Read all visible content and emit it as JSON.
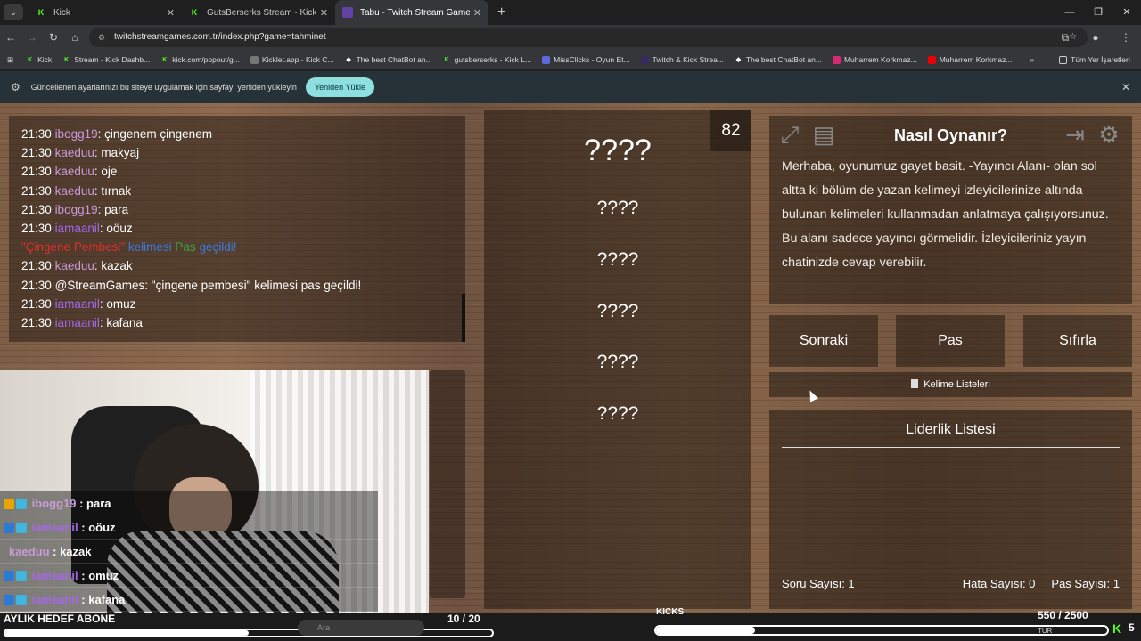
{
  "browser": {
    "tabs": [
      {
        "title": "Kick",
        "icon": "kick-icon",
        "active": false
      },
      {
        "title": "GutsBerserks Stream - Kick Dashboard",
        "icon": "kick-icon",
        "active": false
      },
      {
        "title": "Tabu - Twitch Stream Games",
        "icon": "twitch-icon",
        "active": true
      }
    ],
    "url": "twitchstreamgames.com.tr/index.php?game=tahminet",
    "bookmarks": [
      "Kick",
      "Stream - Kick Dashb...",
      "kick.com/popout/g...",
      "Kicklet.app - Kick C...",
      "The best ChatBot an...",
      "gutsberserks - Kick L...",
      "MissClicks - Oyun Et...",
      "Twitch & Kick Strea...",
      "The best ChatBot an...",
      "Muharrem Korkmaz...",
      "Muharrem Korkmaz..."
    ],
    "all_bookmarks": "Tüm Yer İşaretleri",
    "infobar": {
      "message": "Güncellenen ayarlarınızı bu siteye uygulamak için sayfayı yeniden yükleyin",
      "button": "Yeniden Yükle"
    }
  },
  "chat": {
    "lines": [
      {
        "time": "21:30",
        "user": "ibogg19",
        "msg": ": çingenem çingenem",
        "ucolor": "pink"
      },
      {
        "time": "21:30",
        "user": "kaeduu",
        "msg": ": makyaj",
        "ucolor": "pink"
      },
      {
        "time": "21:30",
        "user": "kaeduu",
        "msg": ": oje",
        "ucolor": "pink"
      },
      {
        "time": "21:30",
        "user": "kaeduu",
        "msg": ": tırnak",
        "ucolor": "pink"
      },
      {
        "time": "21:30",
        "user": "ibogg19",
        "msg": ": para",
        "ucolor": "pink"
      },
      {
        "time": "21:30",
        "user": "iamaanil",
        "msg": ": oöuz",
        "ucolor": "purple"
      }
    ],
    "pass_notice": {
      "word": "\"Çingene Pembesi\"",
      "mid": " kelimesi ",
      "pas": "Pas",
      "end": " geçildi!"
    },
    "lines2": [
      {
        "time": "21:30",
        "user": "kaeduu",
        "msg": ": kazak",
        "ucolor": "pink"
      },
      {
        "time": "21:30",
        "user": "@StreamGames",
        "msg": ": \"çingene pembesi\" kelimesi pas geçildi!",
        "ucolor": "white"
      },
      {
        "time": "21:30",
        "user": "iamaanil",
        "msg": ": omuz",
        "ucolor": "purple"
      },
      {
        "time": "21:30",
        "user": "iamaanil",
        "msg": ": kafana",
        "ucolor": "purple"
      }
    ]
  },
  "game": {
    "counter": "82",
    "main_word": "????",
    "hidden_words": [
      "????",
      "????",
      "????",
      "????",
      "????"
    ]
  },
  "howto": {
    "title": "Nasıl Oynanır?",
    "body": "Merhaba, oyunumuz gayet basit. -Yayıncı Alanı- olan sol altta ki bölüm de yazan kelimeyi izleyicilerinize altında bulunan kelimeleri kullanmadan anlatmaya çalışıyorsunuz. Bu alanı sadece yayıncı görmelidir. İzleyicileriniz yayın chatinizde cevap verebilir."
  },
  "buttons": {
    "next": "Sonraki",
    "pass": "Pas",
    "reset": "Sıfırla"
  },
  "word_lists": "Kelime Listeleri",
  "leaderboard": {
    "title": "Liderlik Listesi",
    "questions": "Soru Sayısı: 1",
    "errors": "Hata Sayısı: 0",
    "passes": "Pas Sayısı: 1"
  },
  "overlay_chat": [
    {
      "user": "ibogg19",
      "msg": " : para"
    },
    {
      "user": "iamaanil",
      "msg": " : oöuz"
    },
    {
      "user": "kaeduu",
      "msg": " : kazak"
    },
    {
      "user": "iamaanil",
      "msg": " : omuz"
    },
    {
      "user": "iamaanil",
      "msg": " : kafana"
    }
  ],
  "stream_overlay": {
    "goal_label": "AYLIK HEDEF ABONE",
    "goal_count": "10 / 20",
    "goal_progress": 0.5,
    "kicks_label": "KICKS",
    "kicks_count": "550 / 2500",
    "kicks_progress": 0.22,
    "kick_num": "5",
    "taskbar_search": "Ara",
    "lang": "TUR"
  },
  "colors": {
    "kick_green": "#53fc18",
    "user_pink": "#c99bd9",
    "user_purple": "#a468e8",
    "accent_teal": "#8ee0df"
  }
}
